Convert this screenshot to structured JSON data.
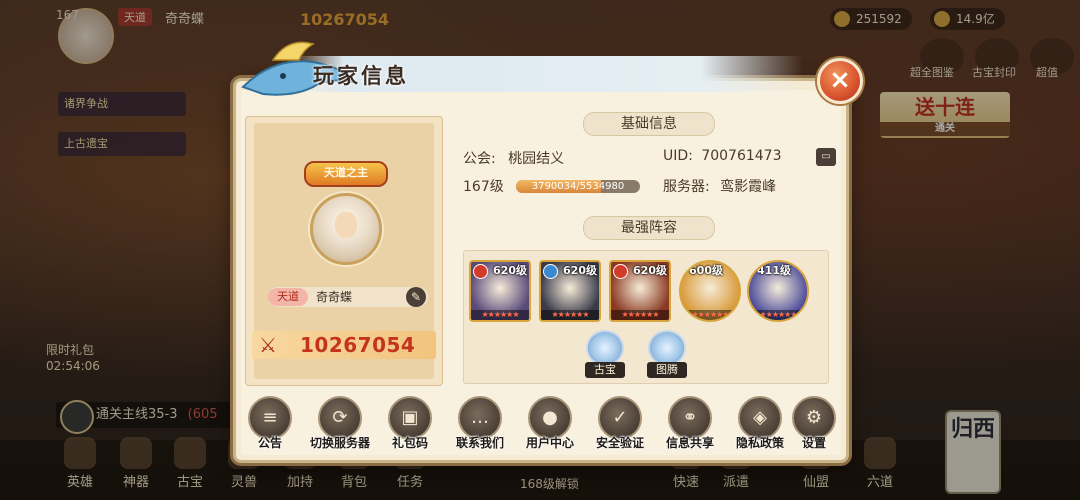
{
  "background": {
    "player_level": "167",
    "player_tag": "天道",
    "player_name": "奇奇蝶",
    "combat_power": "10267054",
    "resource_1": "251592",
    "resource_2": "14.9亿",
    "left_menu": [
      "诸界争战",
      "上古遗宝"
    ],
    "right_buttons": [
      "超全图鉴",
      "古宝封印",
      "超值"
    ],
    "send_banner": "送十连",
    "send_banner_sub": "通关",
    "timer_label": "限时礼包",
    "timer_value": "02:54:06",
    "main_quest": "通关主线35-3",
    "main_quest_extra": "(605",
    "nav": [
      "英雄",
      "神器",
      "古宝",
      "灵兽",
      "加持",
      "背包",
      "任务",
      "快速",
      "派遣",
      "仙盟",
      "六道"
    ],
    "unlock_text": "168级解锁",
    "scroll_text": "归西"
  },
  "dialog": {
    "title": "玩家信息",
    "close_symbol": "×",
    "profile": {
      "title_badge": "天道之主",
      "name_tag": "天道",
      "name": "奇奇蝶",
      "power": "10267054"
    },
    "basic_info": {
      "header": "基础信息",
      "guild_label": "公会:",
      "guild_value": "桃园结义",
      "uid_label": "UID:",
      "uid_value": "700761473",
      "level": "167级",
      "exp_current": 3790034,
      "exp_max": 5534980,
      "exp_text": "3790034/5534980",
      "server_label": "服务器:",
      "server_value": "鸾影霞峰"
    },
    "lineup": {
      "header": "最强阵容",
      "heroes": [
        {
          "level": "620级",
          "stars": "★★★★★★",
          "camp_color": "#d23a2a",
          "bg": "#5a4a7a"
        },
        {
          "level": "620级",
          "stars": "★★★★★★",
          "camp_color": "#3a8ad2",
          "bg": "#3a3a4a"
        },
        {
          "level": "620级",
          "stars": "★★★★★★",
          "camp_color": "#d23a2a",
          "bg": "#8a3a22"
        },
        {
          "level": "600级",
          "stars": "★★★★★★",
          "camp_color": "",
          "bg": "#d89a3a"
        },
        {
          "level": "411级",
          "stars": "★★★★★★",
          "camp_color": "",
          "bg": "#4a4a9a"
        }
      ],
      "extras": [
        "古宝",
        "图腾"
      ]
    },
    "actions": [
      {
        "label": "公告",
        "icon": "≡"
      },
      {
        "label": "切换服务器",
        "icon": "⟳"
      },
      {
        "label": "礼包码",
        "icon": "▣"
      },
      {
        "label": "联系我们",
        "icon": "…"
      },
      {
        "label": "用户中心",
        "icon": "●"
      },
      {
        "label": "安全验证",
        "icon": "✓"
      },
      {
        "label": "信息共享",
        "icon": "⚭"
      },
      {
        "label": "隐私政策",
        "icon": "◈"
      },
      {
        "label": "设置",
        "icon": "⚙"
      }
    ]
  }
}
